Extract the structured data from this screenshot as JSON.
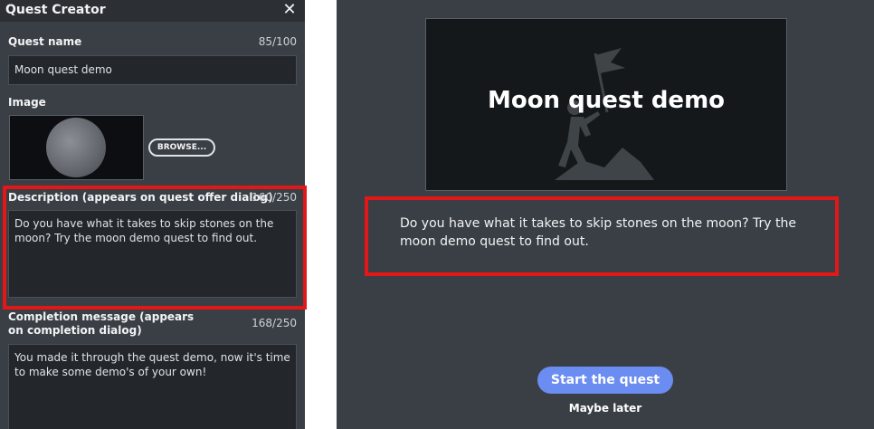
{
  "panel": {
    "title": "Quest Creator",
    "close_icon": "close-icon",
    "quest_name": {
      "label": "Quest name",
      "counter": "85/100",
      "value": "Moon quest demo"
    },
    "image": {
      "label": "Image",
      "browse_label": "BROWSE..."
    },
    "description": {
      "label": "Description (appears on quest offer dialog)",
      "counter": "160/250",
      "value": "Do you have what it takes to skip stones on the moon? Try the moon demo quest to find out."
    },
    "completion": {
      "label": "Completion message (appears on completion dialog)",
      "counter": "168/250",
      "value": "You made it through the quest demo, now it's time to make some demo's of your own!"
    }
  },
  "preview": {
    "title": "Moon quest demo",
    "hero_icon": "climber-flag-icon",
    "description": "Do you have what it takes to skip stones on the moon? Try the moon demo quest to find out.",
    "start_label": "Start the quest",
    "later_label": "Maybe later"
  },
  "colors": {
    "panel_bg": "#3a3f45",
    "header_bg": "#2c3035",
    "field_bg": "#23272b",
    "highlight": "#e31717",
    "accent": "#6b8cf0"
  }
}
